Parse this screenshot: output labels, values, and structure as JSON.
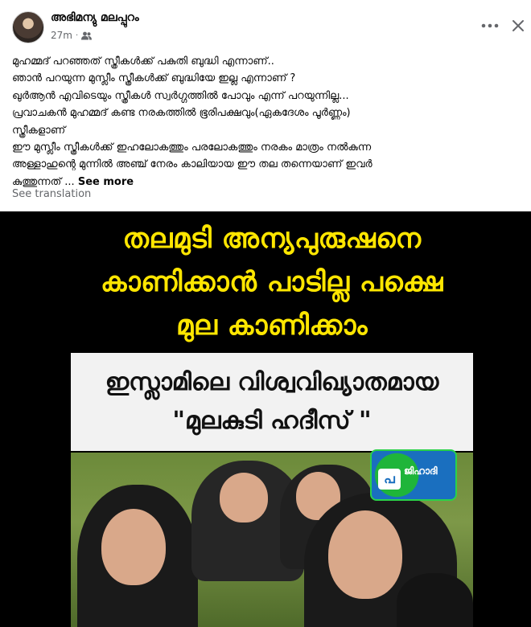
{
  "post": {
    "author": "അഭിമന്യു മലപ്പുറം",
    "time": "27m",
    "separator": "·",
    "audience_icon": "friends-icon",
    "more_label": "•••",
    "close_label": "✕",
    "text_lines": [
      "മുഹമ്മദ് പറഞ്ഞത് സ്ത്രീകൾക്ക് പകുതി ബുദ്ധി എന്നാണ്..",
      "ഞാൻ പറയുന്ന മുസ്ലീം സ്ത്രീകൾക്ക് ബുദ്ധിയേ ഇല്ല എന്നാണ് ?",
      "ഖുർആൻ എവിടെയും സ്ത്രീകൾ സ്വർഗ്ഗത്തിൽ പോവും എന്ന് പറയുന്നില്ല...",
      "പ്രവാചകൻ മുഹമ്മദ് കണ്ട നരകത്തിൽ ഭൂരിപക്ഷവും(ഏകദേശം പൂർണ്ണം)",
      "സ്ത്രീകളാണ്",
      "ഈ മുസ്ലീം സ്ത്രീകൾക്ക് ഇഹലോകത്തും പരലോകത്തും നരകം മാത്രം നൽകുന്ന",
      "അള്ളാഹുന്റെ മുന്നിൽ അഞ്ച് നേരം കാലിയായ ഈ തല തന്നെയാണ് ഇവർ"
    ],
    "last_line": "കുത്തുന്നത് ...",
    "see_more": "See more",
    "see_translation": "See translation"
  },
  "image": {
    "headline_lines": [
      "തലമുടി അന്യപുരുഷനെ",
      "കാണിക്കാൻ പാടില്ല പക്ഷെ",
      "മുല കാണിക്കാം"
    ],
    "band_lines": [
      "ഇസ്ലാമിലെ വിശ്വവിഖ്യാതമായ",
      "\"മുലകുടി ഹദീസ് \""
    ],
    "logo_text": "ജിഹാദി",
    "logo_mark": "പ",
    "colors": {
      "headline": "#ffe600",
      "band": "#f2f2f2",
      "logo_bg": "#1a6fbf",
      "logo_accent": "#2ad24a"
    }
  }
}
